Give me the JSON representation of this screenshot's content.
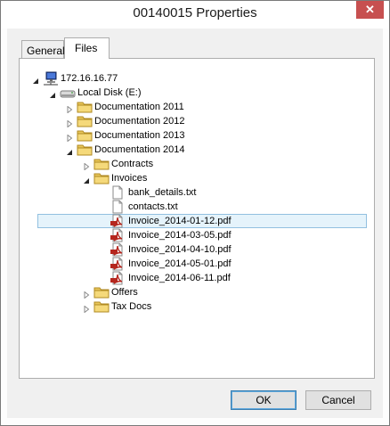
{
  "window": {
    "title": "00140015 Properties",
    "close_glyph": "✕"
  },
  "tabs": [
    {
      "label": "General"
    },
    {
      "label": "Files"
    }
  ],
  "tree": {
    "items": [
      {
        "label": "172.16.16.77",
        "icon": "network-computer-icon",
        "level": 0,
        "state": "expanded"
      },
      {
        "label": "Local Disk (E:)",
        "icon": "drive-icon",
        "level": 1,
        "state": "expanded"
      },
      {
        "label": "Documentation 2011",
        "icon": "folder-icon",
        "level": 2,
        "state": "collapsed"
      },
      {
        "label": "Documentation 2012",
        "icon": "folder-icon",
        "level": 2,
        "state": "collapsed"
      },
      {
        "label": "Documentation 2013",
        "icon": "folder-icon",
        "level": 2,
        "state": "collapsed"
      },
      {
        "label": "Documentation 2014",
        "icon": "folder-icon",
        "level": 2,
        "state": "expanded"
      },
      {
        "label": "Contracts",
        "icon": "folder-icon",
        "level": 3,
        "state": "collapsed"
      },
      {
        "label": "Invoices",
        "icon": "folder-icon",
        "level": 3,
        "state": "expanded"
      },
      {
        "label": "bank_details.txt",
        "icon": "text-file-icon",
        "level": 4,
        "state": "leaf"
      },
      {
        "label": "contacts.txt",
        "icon": "text-file-icon",
        "level": 4,
        "state": "leaf"
      },
      {
        "label": "Invoice_2014-01-12.pdf",
        "icon": "pdf-file-icon",
        "level": 4,
        "state": "leaf",
        "selected": true
      },
      {
        "label": "Invoice_2014-03-05.pdf",
        "icon": "pdf-file-icon",
        "level": 4,
        "state": "leaf"
      },
      {
        "label": "Invoice_2014-04-10.pdf",
        "icon": "pdf-file-icon",
        "level": 4,
        "state": "leaf"
      },
      {
        "label": "Invoice_2014-05-01.pdf",
        "icon": "pdf-file-icon",
        "level": 4,
        "state": "leaf"
      },
      {
        "label": "Invoice_2014-06-11.pdf",
        "icon": "pdf-file-icon",
        "level": 4,
        "state": "leaf"
      },
      {
        "label": "Offers",
        "icon": "folder-icon",
        "level": 3,
        "state": "collapsed"
      },
      {
        "label": "Tax Docs",
        "icon": "folder-icon",
        "level": 3,
        "state": "collapsed"
      }
    ]
  },
  "buttons": {
    "ok": "OK",
    "cancel": "Cancel"
  },
  "colors": {
    "selection": "#e5f3fb",
    "selection_border": "#92c0e0",
    "close_button": "#c75050",
    "folder": "#e8c65a",
    "pdf": "#b5261e"
  }
}
